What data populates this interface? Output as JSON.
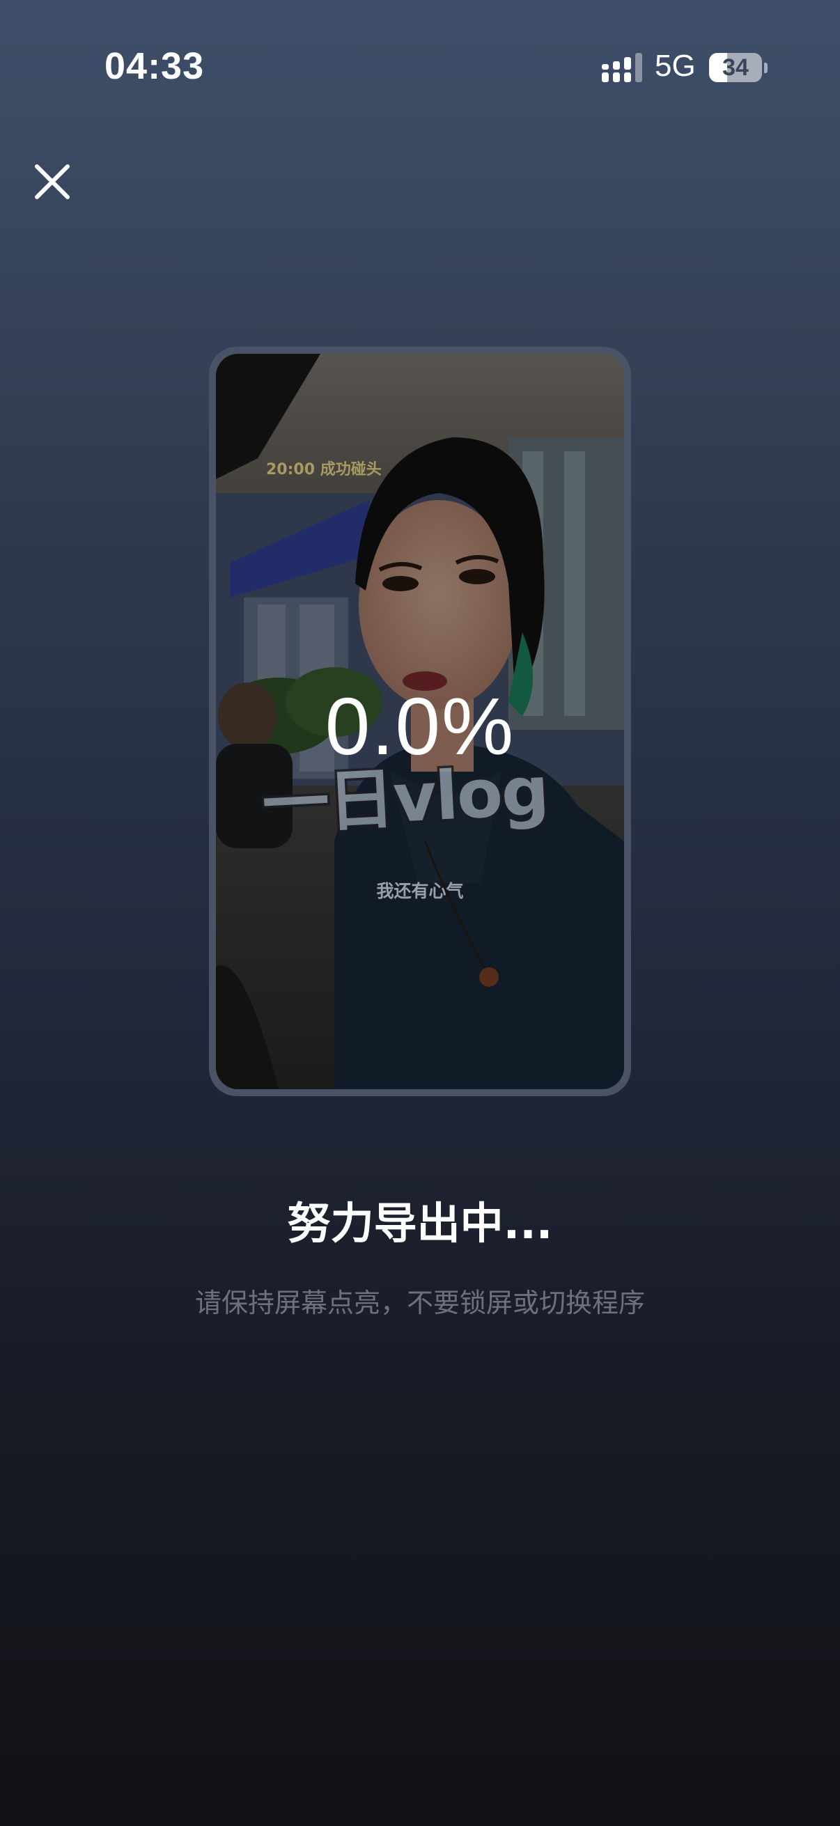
{
  "status_bar": {
    "time": "04:33",
    "network": "5G",
    "battery_level": "34",
    "battery_fraction": 0.34
  },
  "preview": {
    "overlay_time_caption": "20:00 成功碰头",
    "overlay_title": "一日vlog",
    "overlay_subtitle": "我还有心气",
    "progress_percent": "0.0%"
  },
  "export": {
    "title": "努力导出中...",
    "hint": "请保持屏幕点亮，不要锁屏或切换程序"
  },
  "icons": {
    "close": "close-icon",
    "signal": "cellular-signal-icon",
    "battery": "battery-icon"
  }
}
